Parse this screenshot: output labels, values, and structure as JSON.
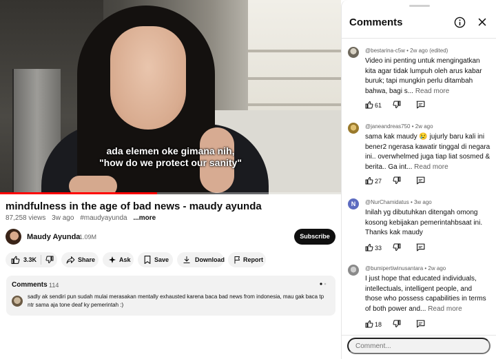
{
  "video": {
    "caption_line1": "ada elemen oke gimana nih,",
    "caption_line2": "\"how do we protect our sanity\"",
    "progress": 0.46
  },
  "meta": {
    "title": "mindfulness in the age of bad news - maudy ayunda",
    "views": "87,258 views",
    "age": "3w ago",
    "hashtag": "#maudyayunda",
    "more": "...more"
  },
  "channel": {
    "name": "Maudy Ayunda",
    "subscribers": "1.09M",
    "subscribe_label": "Subscribe"
  },
  "actions": {
    "like_count": "3.3K",
    "share": "Share",
    "ask": "Ask",
    "save": "Save",
    "download": "Download",
    "report": "Report"
  },
  "comments_preview": {
    "header": "Comments",
    "count": "114",
    "text": "sadly ak sendiri pun sudah mulai merasakan mentally exhausted karena baca bad news from indonesia, mau gak baca tp ntr sama aja tone deaf ky pemerintah :)"
  },
  "panel": {
    "title": "Comments",
    "input_placeholder": "Comment...",
    "comments": [
      {
        "author": "@bestarina-c5w",
        "meta": "• 2w ago (edited)",
        "text": "Video ini penting untuk mengingatkan kita agar tidak lumpuh oleh arus kabar buruk; tapi mungkin perlu ditambah bahwa, bagi s...",
        "read_more": "Read more",
        "likes": "61",
        "avatar_color": "#8a8577"
      },
      {
        "author": "@janeandreas750",
        "meta": "• 2w ago",
        "text": "sama kak maudy 😢 jujurly baru kali ini bener2 ngerasa kawatir tinggal di negara ini.. overwhelmed juga tiap liat sosmed & berita.. Ga int...",
        "read_more": "Read more",
        "likes": "27",
        "avatar_color": "#b8943a"
      },
      {
        "author": "@NurChamidatus",
        "meta": "• 3w ago",
        "text": "Inilah yg dibutuhkan ditengah omong kosong kebijakan pemerintahbsaat ini. Thanks kak maudy",
        "read_more": "",
        "likes": "33",
        "avatar_letter": "N",
        "avatar_color": "#5c6bc0"
      },
      {
        "author": "@bumipertiwinusantara",
        "meta": "• 2w ago",
        "text": "I just hope that educated individuals, intellectuals, intelligent people, and those who possess capabilities in terms of both power and...",
        "read_more": "Read more",
        "likes": "18",
        "avatar_color": "#9e9e9e"
      }
    ]
  },
  "colors": {
    "progress_red": "#ff0000",
    "subscribe_bg": "#0f0f0f",
    "chip_bg": "#f2f2f2"
  }
}
